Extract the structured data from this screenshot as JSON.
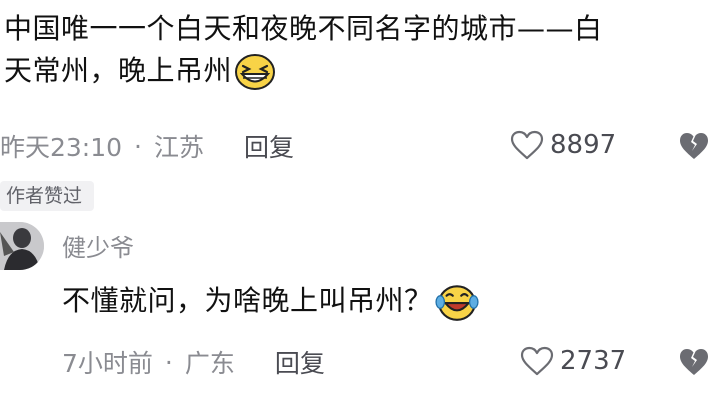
{
  "comment": {
    "line1": "中国唯一一个白天和夜晚不同名字的城市——白",
    "line2": "天常州，晚上吊州",
    "emoji_icon": "grinning-squint-emoji",
    "time": "昨天23:10",
    "separator": "·",
    "location": "江苏",
    "reply_label": "回复",
    "like_count": "8897"
  },
  "author_liked_badge": "作者赞过",
  "reply": {
    "username": "健少爷",
    "text": "不懂就问，为啥晚上叫吊州？",
    "emoji_icon": "laugh-tears-emoji",
    "time": "7小时前",
    "separator": "·",
    "location": "广东",
    "reply_label": "回复",
    "like_count": "2737"
  },
  "colors": {
    "meta_gray": "#8a8b91",
    "text": "#111111",
    "badge_bg": "#f1f1f3",
    "emoji_yellow": "#f8d347"
  }
}
